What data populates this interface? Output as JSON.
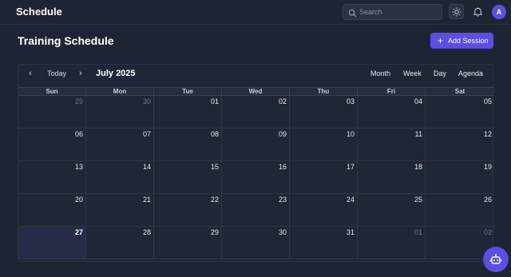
{
  "topbar": {
    "title": "Schedule",
    "search_placeholder": "Search",
    "avatar_initial": "A"
  },
  "page": {
    "title": "Training Schedule",
    "add_button": "Add Session"
  },
  "calendar": {
    "today_label": "Today",
    "month_label": "July 2025",
    "views": [
      "Month",
      "Week",
      "Day",
      "Agenda"
    ],
    "weekdays": [
      "Sun",
      "Mon",
      "Tue",
      "Wed",
      "Thu",
      "Fri",
      "Sat"
    ],
    "weeks": [
      [
        {
          "d": "29",
          "other": true
        },
        {
          "d": "30",
          "other": true
        },
        {
          "d": "01"
        },
        {
          "d": "02"
        },
        {
          "d": "03"
        },
        {
          "d": "04"
        },
        {
          "d": "05"
        }
      ],
      [
        {
          "d": "06"
        },
        {
          "d": "07"
        },
        {
          "d": "08"
        },
        {
          "d": "09"
        },
        {
          "d": "10"
        },
        {
          "d": "11"
        },
        {
          "d": "12"
        }
      ],
      [
        {
          "d": "13"
        },
        {
          "d": "14"
        },
        {
          "d": "15"
        },
        {
          "d": "16"
        },
        {
          "d": "17"
        },
        {
          "d": "18"
        },
        {
          "d": "19"
        }
      ],
      [
        {
          "d": "20"
        },
        {
          "d": "21"
        },
        {
          "d": "22"
        },
        {
          "d": "23"
        },
        {
          "d": "24"
        },
        {
          "d": "25"
        },
        {
          "d": "26"
        }
      ],
      [
        {
          "d": "27",
          "today": true
        },
        {
          "d": "28"
        },
        {
          "d": "29"
        },
        {
          "d": "30"
        },
        {
          "d": "31"
        },
        {
          "d": "01",
          "other": true
        },
        {
          "d": "02",
          "other": true
        }
      ]
    ]
  },
  "colors": {
    "accent": "#5b4fe0",
    "background": "#1e2433"
  },
  "icons": [
    "search-icon",
    "sun-icon",
    "bell-icon",
    "plus-icon",
    "chevron-left-icon",
    "chevron-right-icon",
    "bot-icon"
  ]
}
